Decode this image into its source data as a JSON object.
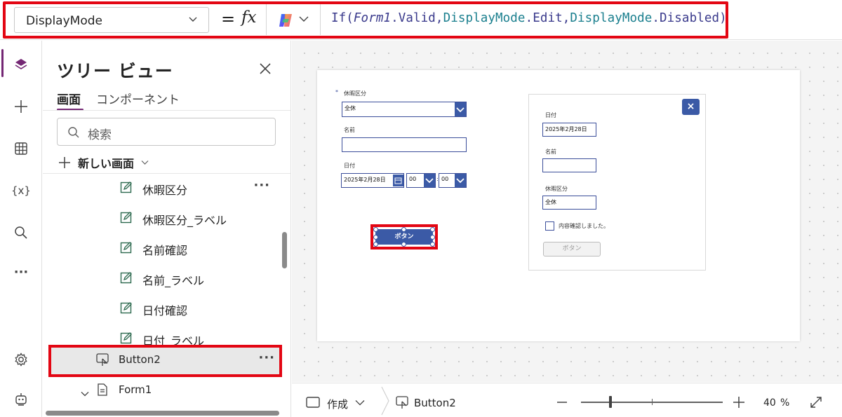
{
  "formula_bar": {
    "property": "DisplayMode",
    "equals": "=",
    "fx": "fx",
    "formula_parts": [
      {
        "t": "If(",
        "c": "f-fn"
      },
      {
        "t": "Form1",
        "c": "f-it"
      },
      {
        "t": ".Valid,",
        "c": "f-pl"
      },
      {
        "t": "DisplayMode",
        "c": "f-tl"
      },
      {
        "t": ".Edit,",
        "c": "f-pl"
      },
      {
        "t": "DisplayMode",
        "c": "f-tl"
      },
      {
        "t": ".Disabled)",
        "c": "f-pl"
      }
    ]
  },
  "tree": {
    "title": "ツリー ビュー",
    "tabs": [
      "画面",
      "コンポーネント"
    ],
    "search_placeholder": "検索",
    "new_screen": "新しい画面",
    "items": [
      {
        "label": "休暇区分",
        "icon": "edit-icon"
      },
      {
        "label": "休暇区分_ラベル",
        "icon": "edit-icon"
      },
      {
        "label": "名前確認",
        "icon": "edit-icon"
      },
      {
        "label": "名前_ラベル",
        "icon": "edit-icon"
      },
      {
        "label": "日付確認",
        "icon": "edit-icon"
      },
      {
        "label": "日付_ラベル",
        "icon": "edit-icon"
      },
      {
        "label": "Button2",
        "icon": "button-icon"
      },
      {
        "label": "Form1",
        "icon": "form-icon"
      }
    ]
  },
  "form_left": {
    "required_mark": "*",
    "leave_label": "休暇区分",
    "leave_value": "全休",
    "name_label": "名前",
    "date_label": "日付",
    "date_value": "2025年2月28日",
    "hour_value": "00",
    "sep": ":",
    "minute_value": "00",
    "button_label": "ボタン"
  },
  "form_right": {
    "close": "×",
    "date_label": "日付",
    "date_value": "2025年2月28日",
    "name_label": "名前",
    "leave_label": "休暇区分",
    "leave_value": "全休",
    "checkbox_label": "内容確認しました。",
    "button_label": "ボタン"
  },
  "status_bar": {
    "mode": "作成",
    "selected": "Button2",
    "zoom_value": "40",
    "zoom_unit": "%"
  },
  "colors": {
    "accent": "#742774",
    "highlight": "#e30613",
    "control_blue": "#3b5aa6"
  }
}
